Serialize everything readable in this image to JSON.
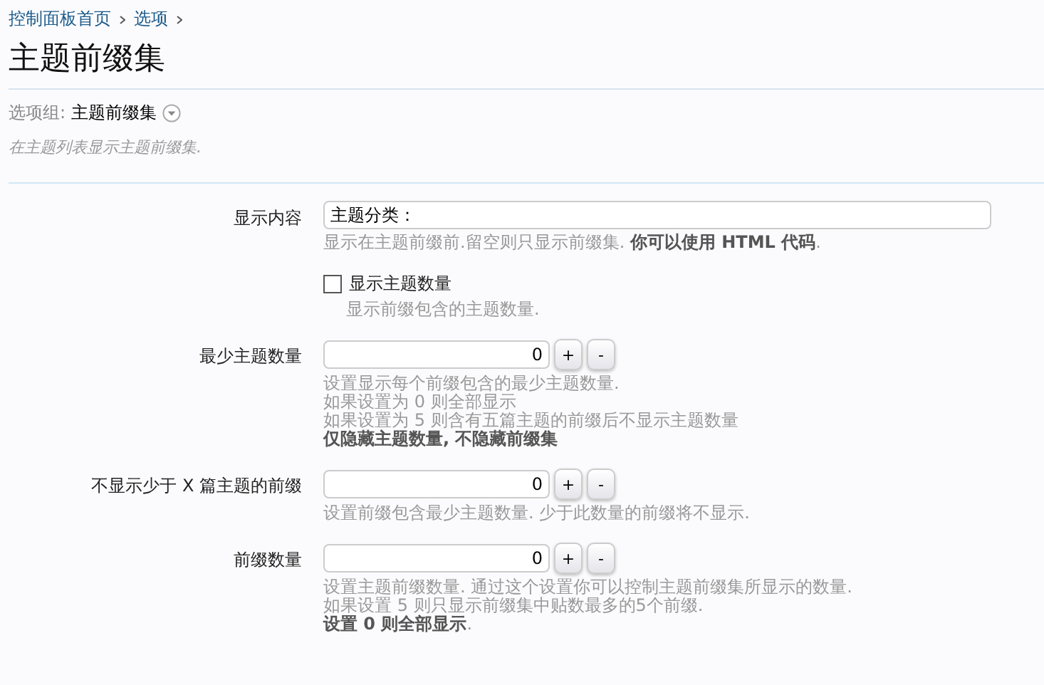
{
  "breadcrumbs": [
    "控制面板首页",
    "选项"
  ],
  "title": "主题前缀集",
  "option_group": {
    "label": "选项组:",
    "value": "主题前缀集"
  },
  "description": "在主题列表显示主题前缀集.",
  "options": [
    {
      "kind": "text",
      "label": "显示内容",
      "value": "主题分类：",
      "hint": [
        "显示在主题前缀前.留空则只显示前缀集. **你可以使用 HTML 代码**."
      ]
    },
    {
      "kind": "checkbox",
      "label": "显示主题数量",
      "checked": false,
      "hint": [
        "显示前缀包含的主题数量."
      ]
    },
    {
      "kind": "spinner",
      "label": "最少主题数量",
      "value": "0",
      "plus": "+",
      "minus": "-",
      "hint": [
        "设置显示每个前缀包含的最少主题数量.",
        "如果设置为 0 则全部显示",
        "如果设置为 5 则含有五篇主题的前缀后不显示主题数量",
        "**仅隐藏主题数量, 不隐藏前缀集**"
      ]
    },
    {
      "kind": "spinner",
      "label": "不显示少于 X 篇主题的前缀",
      "value": "0",
      "plus": "+",
      "minus": "-",
      "hint": [
        "设置前缀包含最少主题数量. 少于此数量的前缀将不显示."
      ]
    },
    {
      "kind": "spinner",
      "label": "前缀数量",
      "value": "0",
      "plus": "+",
      "minus": "-",
      "hint": [
        "设置主题前缀数量. 通过这个设置你可以控制主题前缀集所显示的数量.",
        "如果设置 5 则只显示前缀集中贴数最多的5个前缀.",
        "**设置 0 则全部显示**."
      ]
    }
  ]
}
